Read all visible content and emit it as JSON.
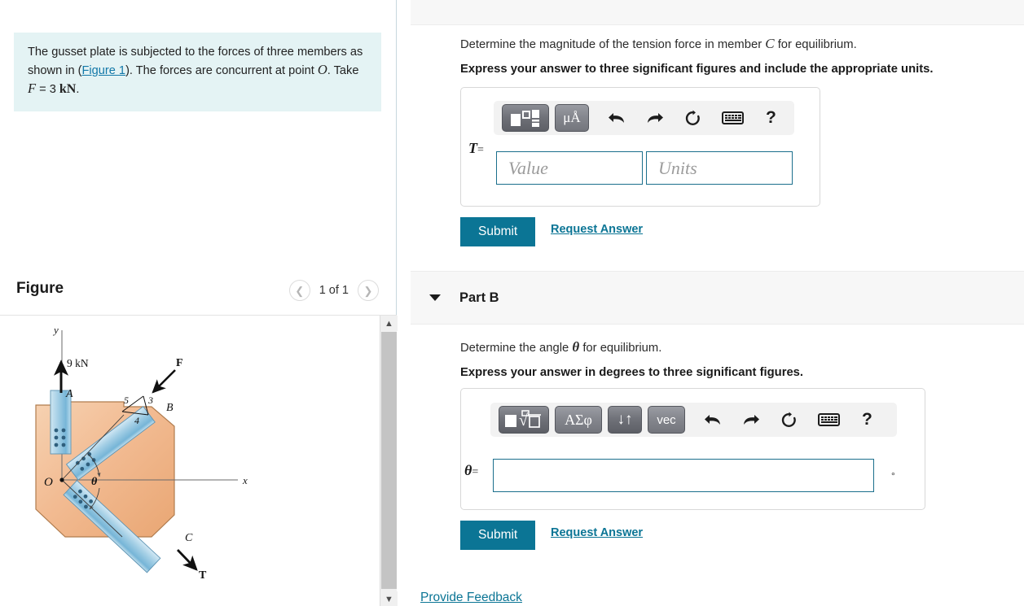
{
  "problem": {
    "text_1": "The gusset plate is subjected to the forces of three",
    "text_2a": "members as shown in (",
    "figure_link": "Figure 1",
    "text_2b": "). The forces are",
    "text_3a": "concurrent at point ",
    "point": "O",
    "text_3b": ". Take ",
    "force_sym": "F",
    "force_val": " = 3 ",
    "force_unit": "kN",
    "period": "."
  },
  "figure_panel": {
    "title": "Figure",
    "prev_icon": "chevron-left",
    "next_icon": "chevron-right",
    "counter": "1 of 1",
    "scroll_up_icon": "chevron-up",
    "scroll_down_icon": "chevron-down"
  },
  "diagram": {
    "axis_y": "y",
    "axis_x": "x",
    "origin": "O",
    "force_a": "9 kN",
    "member_a": "A",
    "member_b": "B",
    "member_c": "C",
    "force_f": "F",
    "force_t": "T",
    "angle": "θ",
    "triangle_5": "5",
    "triangle_3": "3",
    "triangle_4": "4",
    "plate_color": "#f0b98a",
    "member_color": "#8fc6e0"
  },
  "part_a": {
    "question": "Determine the magnitude of the tension force in member ",
    "question_sym": "C",
    "question_end": " for equilibrium.",
    "instruction": "Express your answer to three significant figures and include the appropriate units.",
    "toolbar": [
      {
        "name": "template-icon",
        "glyph": "layout"
      },
      {
        "name": "units-icon",
        "glyph": "μÅ"
      },
      {
        "name": "undo-icon",
        "glyph": "undo"
      },
      {
        "name": "redo-icon",
        "glyph": "redo"
      },
      {
        "name": "reset-icon",
        "glyph": "reset"
      },
      {
        "name": "keyboard-icon",
        "glyph": "keyboard"
      },
      {
        "name": "help-icon",
        "glyph": "?"
      }
    ],
    "label": "T",
    "equals": "=",
    "value_placeholder": "Value",
    "units_placeholder": "Units",
    "value": "",
    "units": "",
    "submit_label": "Submit",
    "request_label": "Request Answer"
  },
  "part_b": {
    "header_label": "Part B",
    "caret_icon": "caret-down",
    "question": "Determine the angle ",
    "question_sym": "θ",
    "question_end": " for equilibrium.",
    "instruction": "Express your answer in degrees to three significant figures.",
    "toolbar": [
      {
        "name": "sqrt-template-icon",
        "glyph": "√"
      },
      {
        "name": "greek-symbols-icon",
        "glyph": "ΑΣφ"
      },
      {
        "name": "arrows-icon",
        "glyph": "↓↑"
      },
      {
        "name": "vector-icon",
        "glyph": "vec"
      },
      {
        "name": "undo-icon",
        "glyph": "undo"
      },
      {
        "name": "redo-icon",
        "glyph": "redo"
      },
      {
        "name": "reset-icon",
        "glyph": "reset"
      },
      {
        "name": "keyboard-icon",
        "glyph": "keyboard"
      },
      {
        "name": "help-icon",
        "glyph": "?"
      }
    ],
    "label": "θ",
    "equals": "=",
    "value": "",
    "degree_unit": "°",
    "submit_label": "Submit",
    "request_label": "Request Answer"
  },
  "footer": {
    "feedback_label": "Provide Feedback"
  },
  "colors": {
    "accent": "#0b7595",
    "prompt_bg": "#e4f3f4",
    "field_border": "#1b6f8c",
    "panel_bg": "#f7f7f7"
  }
}
